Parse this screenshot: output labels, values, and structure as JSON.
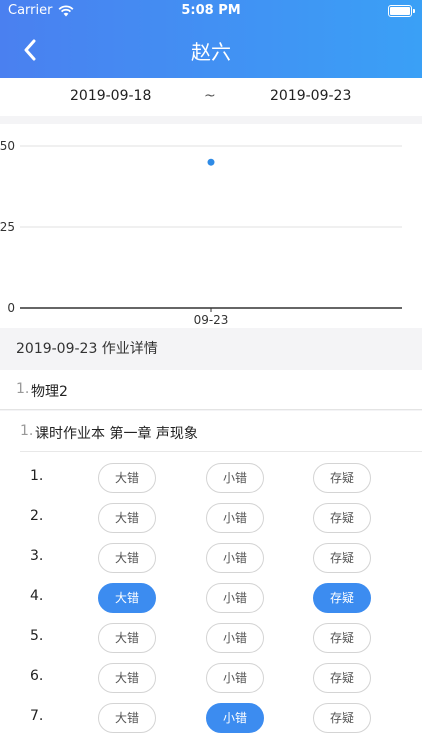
{
  "status": {
    "carrier": "Carrier",
    "time": "5:08 PM"
  },
  "nav": {
    "title": "赵六"
  },
  "date_range": {
    "start": "2019-09-18",
    "separator": "~",
    "end": "2019-09-23"
  },
  "chart_data": {
    "type": "scatter",
    "x": [
      "09-23"
    ],
    "values": [
      45
    ],
    "yticks": [
      "0",
      "25",
      "50"
    ],
    "ylim": [
      0,
      50
    ],
    "grid": true,
    "color": "#2f8be6"
  },
  "detail": {
    "title": "2019-09-23 作业详情"
  },
  "subject": {
    "index": "1.",
    "name": "物理2"
  },
  "book": {
    "index": "1.",
    "name": "课时作业本 第一章 声现象"
  },
  "questions": [
    {
      "num": "1.",
      "options": [
        {
          "label": "大错",
          "active": false
        },
        {
          "label": "小错",
          "active": false
        },
        {
          "label": "存疑",
          "active": false
        }
      ]
    },
    {
      "num": "2.",
      "options": [
        {
          "label": "大错",
          "active": false
        },
        {
          "label": "小错",
          "active": false
        },
        {
          "label": "存疑",
          "active": false
        }
      ]
    },
    {
      "num": "3.",
      "options": [
        {
          "label": "大错",
          "active": false
        },
        {
          "label": "小错",
          "active": false
        },
        {
          "label": "存疑",
          "active": false
        }
      ]
    },
    {
      "num": "4.",
      "options": [
        {
          "label": "大错",
          "active": true
        },
        {
          "label": "小错",
          "active": false
        },
        {
          "label": "存疑",
          "active": true
        }
      ]
    },
    {
      "num": "5.",
      "options": [
        {
          "label": "大错",
          "active": false
        },
        {
          "label": "小错",
          "active": false
        },
        {
          "label": "存疑",
          "active": false
        }
      ]
    },
    {
      "num": "6.",
      "options": [
        {
          "label": "大错",
          "active": false
        },
        {
          "label": "小错",
          "active": false
        },
        {
          "label": "存疑",
          "active": false
        }
      ]
    },
    {
      "num": "7.",
      "options": [
        {
          "label": "大错",
          "active": false
        },
        {
          "label": "小错",
          "active": true
        },
        {
          "label": "存疑",
          "active": false
        }
      ]
    }
  ],
  "colors": {
    "accent": "#3c8cf0",
    "header_start": "#4a80f0",
    "header_end": "#3aa0f6"
  }
}
